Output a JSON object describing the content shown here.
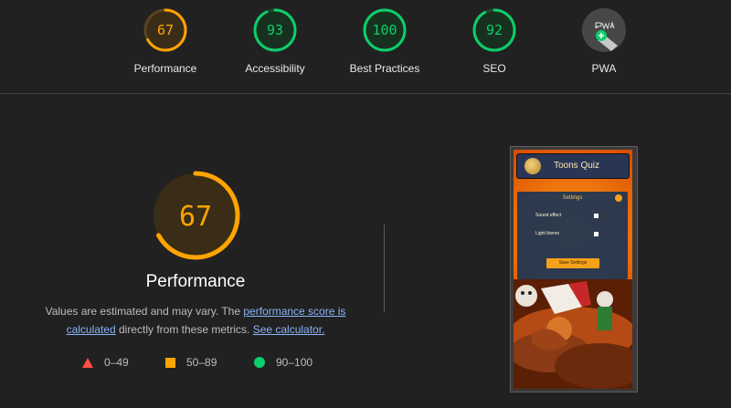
{
  "scores": [
    {
      "label": "Performance",
      "value": "67",
      "color": "#ffa400",
      "fraction": 0.67
    },
    {
      "label": "Accessibility",
      "value": "93",
      "color": "#0cce6b",
      "fraction": 0.93
    },
    {
      "label": "Best Practices",
      "value": "100",
      "color": "#0cce6b",
      "fraction": 1.0
    },
    {
      "label": "SEO",
      "value": "92",
      "color": "#0cce6b",
      "fraction": 0.92
    },
    {
      "label": "PWA",
      "icon": "pwa-badge-icon"
    }
  ],
  "main": {
    "score": "67",
    "fraction": 0.67,
    "color": "#ffa400",
    "title": "Performance",
    "desc_1": "Values are estimated and may vary. The ",
    "link_1": "performance score is calculated",
    "desc_2": " directly from these metrics. ",
    "link_2": "See calculator."
  },
  "legend": [
    {
      "range": "0–49",
      "color": "#ff4e42",
      "shape": "triangle"
    },
    {
      "range": "50–89",
      "color": "#ffa400",
      "shape": "square"
    },
    {
      "range": "90–100",
      "color": "#0cce6b",
      "shape": "circle"
    }
  ],
  "screenshot": {
    "app_title": "Toons Quiz",
    "settings_title": "Settings",
    "option_1": "Sound effect",
    "option_2": "Light theme",
    "button": "Save Settings"
  }
}
